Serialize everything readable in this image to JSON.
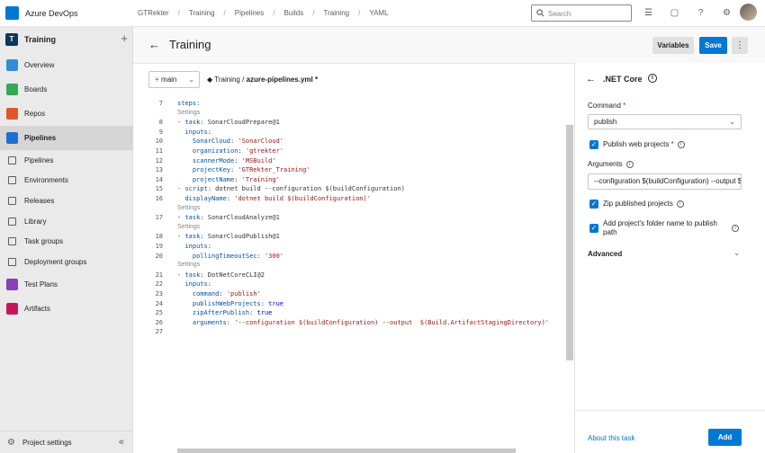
{
  "topbar": {
    "brand": "Azure DevOps",
    "breadcrumb": [
      "GTRekter",
      "Training",
      "Pipelines",
      "Builds",
      "Training",
      "YAML"
    ],
    "search_placeholder": "Search"
  },
  "sidebar": {
    "project_badge": "T",
    "project_name": "Training",
    "items": [
      {
        "label": "Overview",
        "color": "#2f8fd6"
      },
      {
        "label": "Boards",
        "color": "#34a853"
      },
      {
        "label": "Repos",
        "color": "#e0562a"
      },
      {
        "label": "Pipelines",
        "color": "#1f6fd1"
      }
    ],
    "sub_items": [
      "Pipelines",
      "Environments",
      "Releases",
      "Library",
      "Task groups",
      "Deployment groups"
    ],
    "items_after": [
      {
        "label": "Test Plans",
        "color": "#8a3fb6"
      },
      {
        "label": "Artifacts",
        "color": "#c2185b"
      }
    ],
    "footer": "Project settings"
  },
  "header": {
    "title": "Training",
    "variables_label": "Variables",
    "save_label": "Save"
  },
  "editor": {
    "branch": "main",
    "repo": "Training",
    "file": "azure-pipelines.yml *",
    "settings_label": "Settings",
    "lines": [
      {
        "n": "7",
        "text": "steps:"
      },
      {
        "n": "8",
        "text": "- task: SonarCloudPrepare@1"
      },
      {
        "n": "9",
        "text": "  inputs:"
      },
      {
        "n": "10",
        "text": "    SonarCloud: 'SonarCloud'"
      },
      {
        "n": "11",
        "text": "    organization: 'gtrekter'"
      },
      {
        "n": "12",
        "text": "    scannerMode: 'MSBuild'"
      },
      {
        "n": "13",
        "text": "    projectKey: 'GTRekter_Training'"
      },
      {
        "n": "14",
        "text": "    projectName: 'Training'"
      },
      {
        "n": "15",
        "text": "- script: dotnet build --configuration $(buildConfiguration)"
      },
      {
        "n": "16",
        "text": "  displayName: 'dotnet build $(buildConfiguration)'"
      },
      {
        "n": "17",
        "text": "- task: SonarCloudAnalyze@1"
      },
      {
        "n": "18",
        "text": "- task: SonarCloudPublish@1"
      },
      {
        "n": "19",
        "text": "  inputs:"
      },
      {
        "n": "20",
        "text": "    pollingTimeoutSec: '300'"
      },
      {
        "n": "21",
        "text": "- task: DotNetCoreCLI@2"
      },
      {
        "n": "22",
        "text": "  inputs:"
      },
      {
        "n": "23",
        "text": "    command: 'publish'"
      },
      {
        "n": "24",
        "text": "    publishWebProjects: true"
      },
      {
        "n": "25",
        "text": "    zipAfterPublish: true"
      },
      {
        "n": "26",
        "text": "    arguments: '--configuration $(buildConfiguration) --output  $(Build.ArtifactStagingDirectory)'"
      },
      {
        "n": "27",
        "text": ""
      }
    ]
  },
  "panel": {
    "title": ".NET Core",
    "command_label": "Command",
    "command_value": "publish",
    "publish_web_label": "Publish web projects",
    "arguments_label": "Arguments",
    "arguments_value": "--configuration $(buildConfiguration) --output $(Build.ArtifactStagingDirectory)",
    "zip_label": "Zip published projects",
    "folder_label": "Add project's folder name to publish path",
    "advanced_label": "Advanced",
    "about_label": "About this task",
    "add_label": "Add"
  }
}
